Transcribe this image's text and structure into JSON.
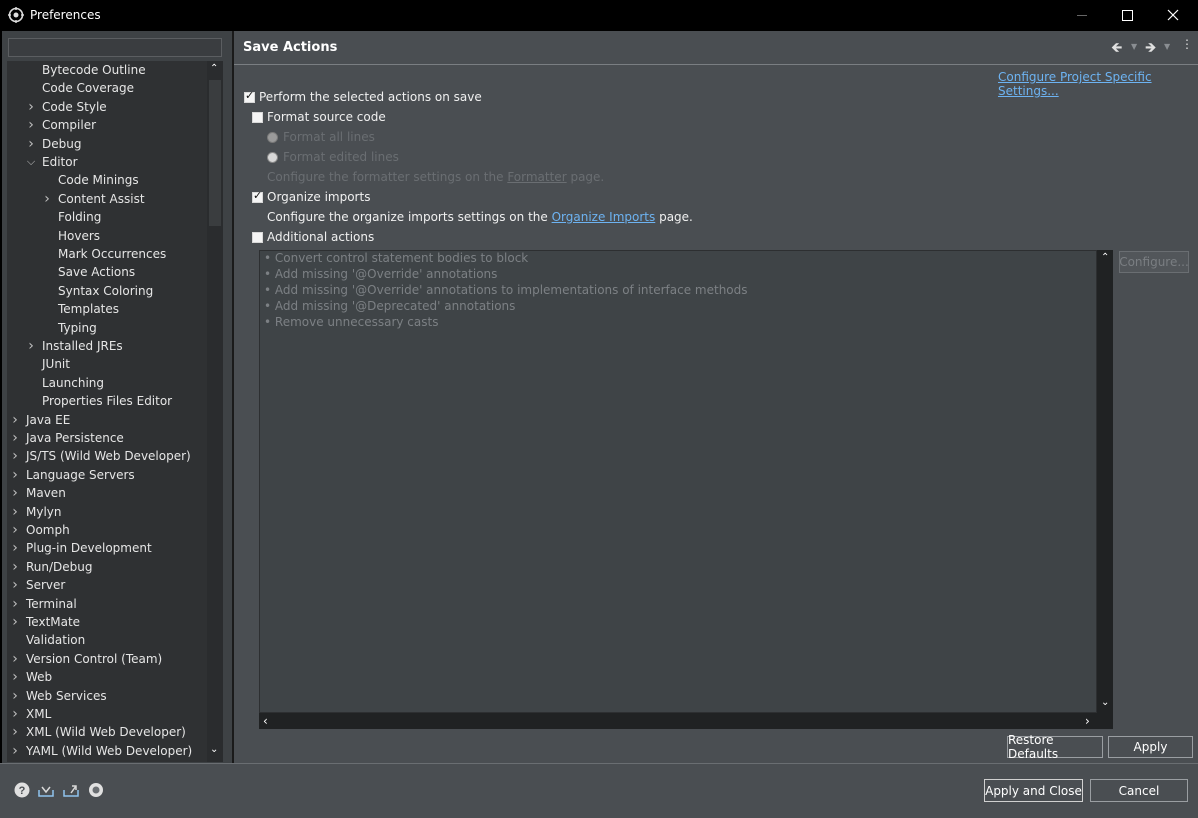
{
  "window": {
    "title": "Preferences",
    "minimize_icon": "minimize-icon",
    "maximize_icon": "maximize-icon",
    "close_icon": "close-icon"
  },
  "filter": {
    "value": "",
    "placeholder": ""
  },
  "tree": [
    {
      "label": "Bytecode Outline",
      "level": 1,
      "arrow": ""
    },
    {
      "label": "Code Coverage",
      "level": 1,
      "arrow": ""
    },
    {
      "label": "Code Style",
      "level": 1,
      "arrow": "collapsed"
    },
    {
      "label": "Compiler",
      "level": 1,
      "arrow": "collapsed"
    },
    {
      "label": "Debug",
      "level": 1,
      "arrow": "collapsed"
    },
    {
      "label": "Editor",
      "level": 1,
      "arrow": "expanded"
    },
    {
      "label": "Code Minings",
      "level": 2,
      "arrow": ""
    },
    {
      "label": "Content Assist",
      "level": 2,
      "arrow": "collapsed"
    },
    {
      "label": "Folding",
      "level": 2,
      "arrow": ""
    },
    {
      "label": "Hovers",
      "level": 2,
      "arrow": ""
    },
    {
      "label": "Mark Occurrences",
      "level": 2,
      "arrow": ""
    },
    {
      "label": "Save Actions",
      "level": 2,
      "arrow": "",
      "selected": true
    },
    {
      "label": "Syntax Coloring",
      "level": 2,
      "arrow": ""
    },
    {
      "label": "Templates",
      "level": 2,
      "arrow": ""
    },
    {
      "label": "Typing",
      "level": 2,
      "arrow": ""
    },
    {
      "label": "Installed JREs",
      "level": 1,
      "arrow": "collapsed"
    },
    {
      "label": "JUnit",
      "level": 1,
      "arrow": ""
    },
    {
      "label": "Launching",
      "level": 1,
      "arrow": ""
    },
    {
      "label": "Properties Files Editor",
      "level": 1,
      "arrow": ""
    },
    {
      "label": "Java EE",
      "level": 0,
      "arrow": "collapsed"
    },
    {
      "label": "Java Persistence",
      "level": 0,
      "arrow": "collapsed"
    },
    {
      "label": "JS/TS (Wild Web Developer)",
      "level": 0,
      "arrow": "collapsed"
    },
    {
      "label": "Language Servers",
      "level": 0,
      "arrow": "collapsed"
    },
    {
      "label": "Maven",
      "level": 0,
      "arrow": "collapsed"
    },
    {
      "label": "Mylyn",
      "level": 0,
      "arrow": "collapsed"
    },
    {
      "label": "Oomph",
      "level": 0,
      "arrow": "collapsed"
    },
    {
      "label": "Plug-in Development",
      "level": 0,
      "arrow": "collapsed"
    },
    {
      "label": "Run/Debug",
      "level": 0,
      "arrow": "collapsed"
    },
    {
      "label": "Server",
      "level": 0,
      "arrow": "collapsed"
    },
    {
      "label": "Terminal",
      "level": 0,
      "arrow": "collapsed"
    },
    {
      "label": "TextMate",
      "level": 0,
      "arrow": "collapsed"
    },
    {
      "label": "Validation",
      "level": 0,
      "arrow": ""
    },
    {
      "label": "Version Control (Team)",
      "level": 0,
      "arrow": "collapsed"
    },
    {
      "label": "Web",
      "level": 0,
      "arrow": "collapsed"
    },
    {
      "label": "Web Services",
      "level": 0,
      "arrow": "collapsed"
    },
    {
      "label": "XML",
      "level": 0,
      "arrow": "collapsed"
    },
    {
      "label": "XML (Wild Web Developer)",
      "level": 0,
      "arrow": "collapsed"
    },
    {
      "label": "YAML (Wild Web Developer)",
      "level": 0,
      "arrow": "collapsed"
    }
  ],
  "page": {
    "title": "Save Actions",
    "project_link": "Configure Project Specific Settings...",
    "perform": {
      "label": "Perform the selected actions on save",
      "checked": true
    },
    "format": {
      "label": "Format source code",
      "checked": false
    },
    "format_all": "Format all lines",
    "format_edited": "Format edited lines",
    "formatter_pre": "Configure the formatter settings on the",
    "formatter_link": "Formatter",
    "formatter_post": "page.",
    "organize": {
      "label": "Organize imports",
      "checked": true
    },
    "organize_pre": "Configure the organize imports settings on the",
    "organize_link": "Organize Imports",
    "organize_post": "page.",
    "additional": {
      "label": "Additional actions",
      "checked": false
    },
    "actions": [
      "Convert control statement bodies to block",
      "Add missing '@Override' annotations",
      "Add missing '@Override' annotations to implementations of interface methods",
      "Add missing '@Deprecated' annotations",
      "Remove unnecessary casts"
    ],
    "configure_btn": "Configure...",
    "restore_btn": "Restore Defaults",
    "apply_btn": "Apply"
  },
  "footer": {
    "apply_close": "Apply and Close",
    "cancel": "Cancel",
    "icons": [
      "help-icon",
      "import-icon",
      "export-icon",
      "preferences-icon"
    ]
  },
  "colors": {
    "link": "#6db3f2",
    "panel": "#4a4e52",
    "tree": "#2f3133",
    "titlebar": "#000000"
  }
}
